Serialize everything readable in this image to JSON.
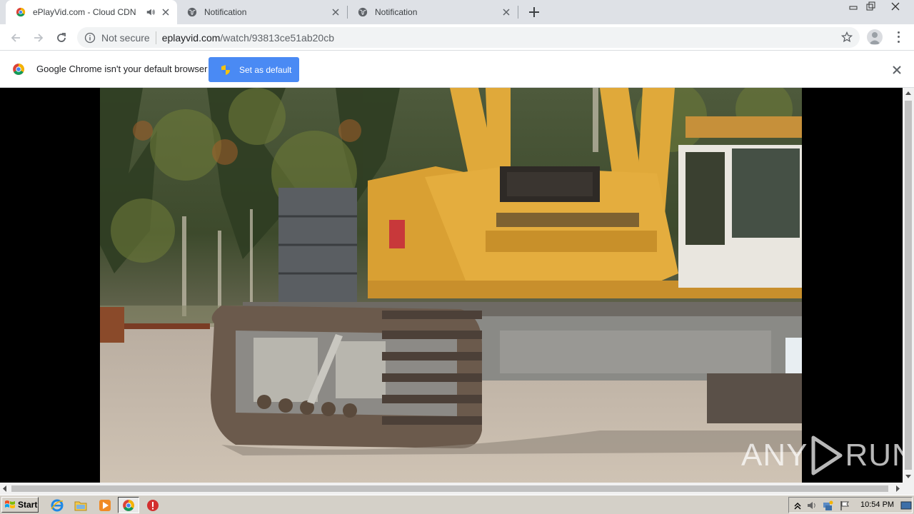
{
  "browser": {
    "tabs": [
      {
        "title": "ePlayVid.com - Cloud CDN",
        "favicon": "chrome-logo-icon",
        "audio": true,
        "active": true
      },
      {
        "title": "Notification",
        "favicon": "globe-icon",
        "audio": false,
        "active": false
      },
      {
        "title": "Notification",
        "favicon": "globe-icon",
        "audio": false,
        "active": false
      }
    ],
    "omnibox": {
      "security_label": "Not secure",
      "domain": "eplayvid.com",
      "path": "/watch/93813ce51ab20cb"
    }
  },
  "infobar": {
    "message": "Google Chrome isn't your default browser",
    "button_label": "Set as default"
  },
  "video": {
    "description_icon": "crane-video-frame"
  },
  "watermark": {
    "left": "ANY",
    "right": "RUN"
  },
  "taskbar": {
    "start_label": "Start",
    "clock": "10:54 PM",
    "pinned": [
      "ie-icon",
      "folder-icon",
      "media-player-icon",
      "chrome-icon",
      "stop-icon"
    ]
  },
  "colors": {
    "accent_button": "#4a8af4",
    "tab_strip": "#dee1e6",
    "taskbar": "#d4d0c8"
  }
}
